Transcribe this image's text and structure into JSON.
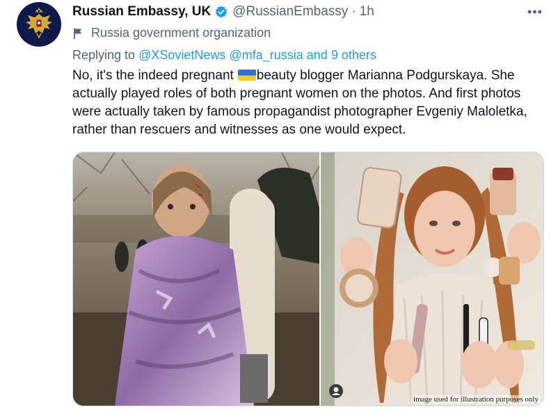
{
  "tweet": {
    "display_name": "Russian Embassy, UK",
    "handle": "@RussianEmbassy",
    "separator": "·",
    "time": "1h",
    "more_label": "•••",
    "account_label": "Russia government organization",
    "reply": {
      "prefix": "Replying to",
      "users": [
        "@XSovietNews",
        "@mfa_russia"
      ],
      "conjunction": "and",
      "others": "9 others"
    },
    "text_before_flag": "No, it's the indeed pregnant",
    "text_after_flag": "beauty blogger Marianna Podgurskaya. She actually played roles of both pregnant women on the photos. And first photos were actually taken by famous propagandist photographer Evgeniy Maloletka, rather than rescuers and witnesses as one would expect.",
    "media_caption": "image used for illustration purposes only"
  },
  "colors": {
    "link": "#1d9bf0",
    "secondary_text": "#536471",
    "verified": "#1d9bf0",
    "avatar_bg": "#0e1a4a",
    "emblem_gold": "#d4a93a"
  },
  "icons": {
    "verified": "verified-badge-icon",
    "label": "government-flag-icon",
    "more": "more-options-icon",
    "emblem": "russian-coat-of-arms-icon",
    "flag": "ukraine-flag-emoji"
  }
}
